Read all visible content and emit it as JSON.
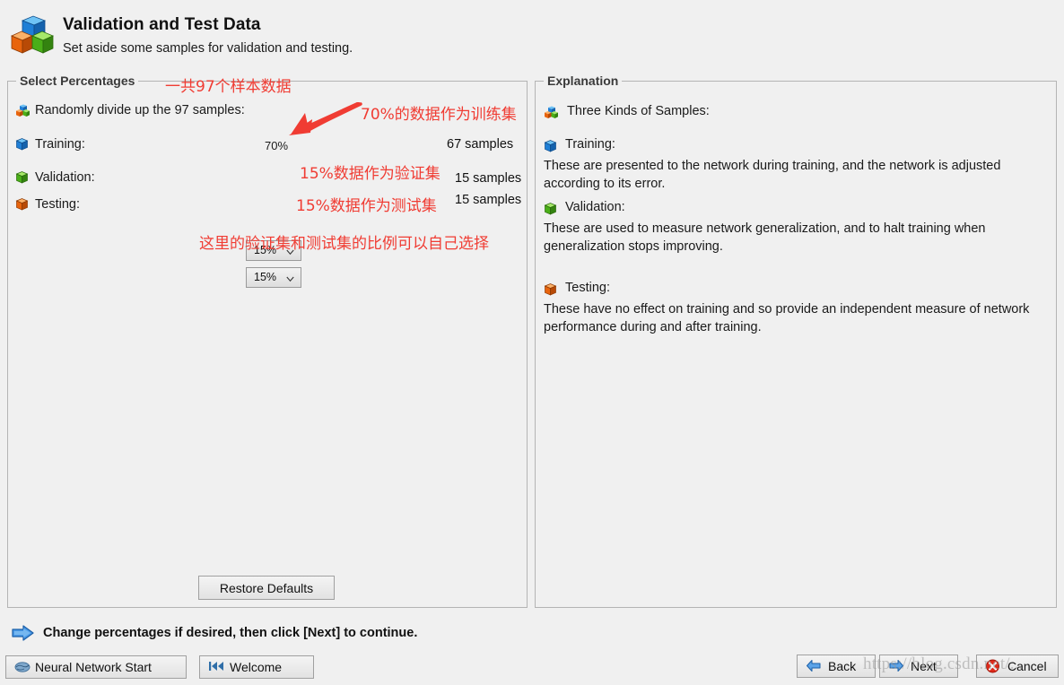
{
  "header": {
    "icon": "three-cubes-icon",
    "title": "Validation and Test Data",
    "subtitle": "Set aside some samples for validation and testing."
  },
  "left_panel": {
    "legend": "Select Percentages",
    "randomly_label": "Randomly divide up the 97 samples:",
    "rows": [
      {
        "icon": "blue-cube-icon",
        "label": "Training:",
        "percent": "70%",
        "editable": false,
        "samples": "67 samples"
      },
      {
        "icon": "green-cube-icon",
        "label": "Validation:",
        "percent": "15%",
        "editable": true,
        "samples": "15 samples"
      },
      {
        "icon": "orange-cube-icon",
        "label": "Testing:",
        "percent": "15%",
        "editable": true,
        "samples": "15 samples"
      }
    ],
    "restore_button": "Restore Defaults"
  },
  "right_panel": {
    "legend": "Explanation",
    "heading": "Three Kinds of Samples:",
    "sections": [
      {
        "icon": "blue-cube-icon",
        "title": "Training:",
        "body": "These are presented to the network during training, and the network is adjusted according to its error."
      },
      {
        "icon": "green-cube-icon",
        "title": "Validation:",
        "body": "These are used to measure network generalization, and to halt training when generalization stops improving."
      },
      {
        "icon": "orange-cube-icon",
        "title": "Testing:",
        "body": "These have no effect on training and so provide an independent measure of network performance during and after training."
      }
    ]
  },
  "status": {
    "icon": "blue-right-arrow-icon",
    "text": "Change percentages if desired, then click [Next] to continue."
  },
  "buttons": {
    "neural_network_start": "Neural Network Start",
    "welcome": "Welcome",
    "back": "Back",
    "next": "Next",
    "cancel": "Cancel"
  },
  "annotations": {
    "total_samples": "一共97个样本数据",
    "training_pct": "70%的数据作为训练集",
    "validation_pct": "15%数据作为验证集",
    "testing_pct": "15%数据作为测试集",
    "choose_note": "这里的验证集和测试集的比例可以自己选择",
    "arrow_color": "#f03c33"
  },
  "watermark": "https://blog.csdn.net/...",
  "colors": {
    "background": "#f0f0f0",
    "border": "#b4b4b4",
    "annotation_red": "#f03c33",
    "cube_blue": "#2f7fd0",
    "cube_green": "#3fa515",
    "cube_orange": "#e2600c"
  }
}
